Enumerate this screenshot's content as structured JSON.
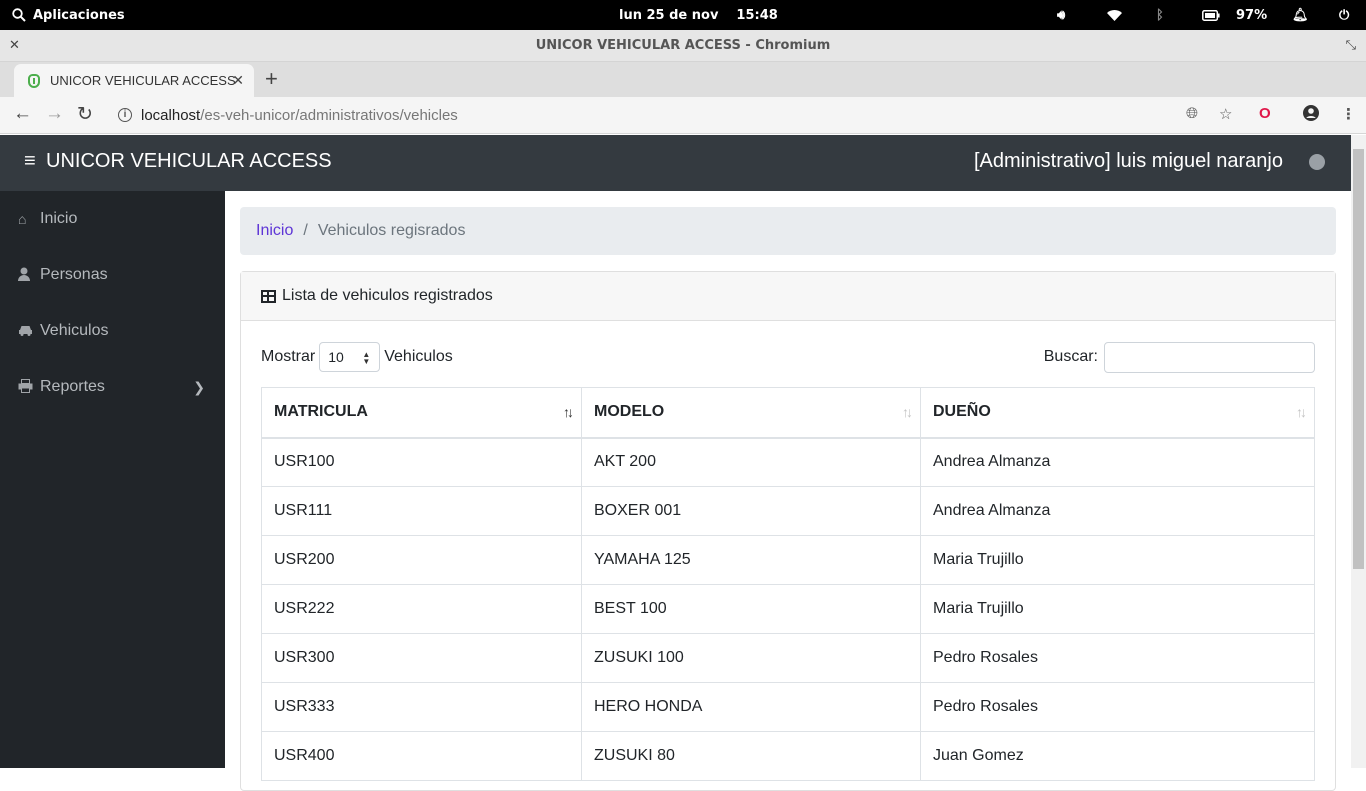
{
  "system": {
    "apps_label": "Aplicaciones",
    "date": "lun 25 de nov",
    "time": "15:48",
    "battery": "97%"
  },
  "browser": {
    "window_title": "UNICOR VEHICULAR ACCESS - Chromium",
    "tab_title": "UNICOR VEHICULAR ACCESS",
    "url_host": "localhost",
    "url_path": "/es-veh-unicor/administrativos/vehicles"
  },
  "header": {
    "brand": "UNICOR VEHICULAR ACCESS",
    "user": "[Administrativo] luis miguel naranjo"
  },
  "sidebar": {
    "items": [
      {
        "label": "Inicio"
      },
      {
        "label": "Personas"
      },
      {
        "label": "Vehiculos"
      },
      {
        "label": "Reportes"
      }
    ]
  },
  "breadcrumb": {
    "home": "Inicio",
    "current": "Vehiculos regisrados"
  },
  "card": {
    "title": "Lista de vehiculos registrados",
    "show_prefix": "Mostrar",
    "show_value": "10",
    "show_suffix": "Vehiculos",
    "search_label": "Buscar:",
    "search_value": ""
  },
  "table": {
    "columns": [
      "MATRICULA",
      "MODELO",
      "DUEÑO"
    ],
    "rows": [
      [
        "USR100",
        "AKT 200",
        "Andrea Almanza"
      ],
      [
        "USR111",
        "BOXER 001",
        "Andrea Almanza"
      ],
      [
        "USR200",
        "YAMAHA 125",
        "Maria Trujillo"
      ],
      [
        "USR222",
        "BEST 100",
        "Maria Trujillo"
      ],
      [
        "USR300",
        "ZUSUKI 100",
        "Pedro Rosales"
      ],
      [
        "USR333",
        "HERO HONDA",
        "Pedro Rosales"
      ],
      [
        "USR400",
        "ZUSUKI 80",
        "Juan Gomez"
      ]
    ]
  }
}
